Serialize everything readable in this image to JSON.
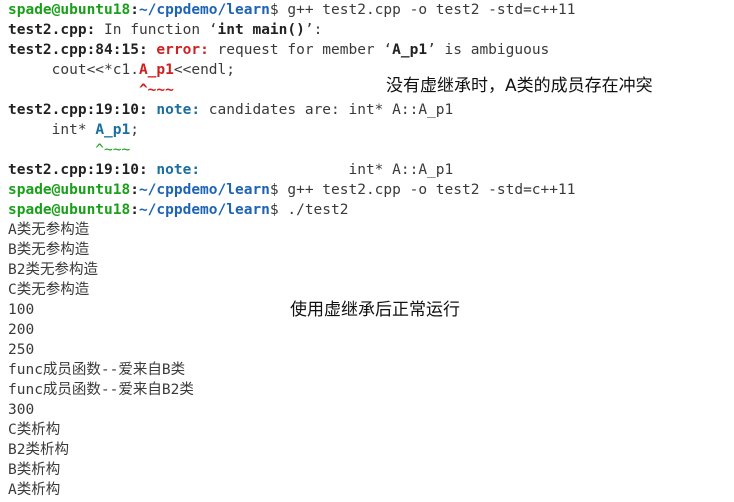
{
  "prompt": {
    "user": "spade@ubuntu18",
    "sep": ":",
    "path": "~/cppdemo/learn",
    "symbol": "$"
  },
  "cmd1": " g++ test2.cpp -o test2 -std=c++11",
  "l2": {
    "file": "test2.cpp:",
    "text": " In function ",
    "quote_open": "‘",
    "fn": "int main()",
    "quote_close": "’:"
  },
  "l3": {
    "loc": "test2.cpp:84:15:",
    "kind": " error:",
    "msg": " request for member ",
    "q1": "‘",
    "member": "A_p1",
    "q2": "’",
    "tail": " is ambiguous"
  },
  "l4": {
    "pre": "     cout<<*c1.",
    "hl": "A_p1",
    "post": "<<endl;"
  },
  "l5": {
    "marker": "               ^~~~"
  },
  "l6": {
    "loc": "test2.cpp:19:10:",
    "kind": " note:",
    "msg": " candidates are: int* A::A_p1"
  },
  "l7": {
    "pre": "     int* ",
    "hl": "A_p1",
    "post": ";"
  },
  "l8": {
    "marker": "          ^~~~"
  },
  "l9": {
    "loc": "test2.cpp:19:10:",
    "kind": " note:",
    "msg": "                 int* A::A_p1"
  },
  "cmd2": " g++ test2.cpp -o test2 -std=c++11",
  "cmd3": " ./test2",
  "output": [
    "A类无参构造",
    "B类无参构造",
    "B2类无参构造",
    "C类无参构造",
    "100",
    "200",
    "250",
    "func成员函数--爱来自B类",
    "func成员函数--爱来自B2类",
    "300",
    "C类析构",
    "B2类析构",
    "B类析构",
    "A类析构"
  ],
  "annotations": {
    "a1": "没有虚继承时，A类的成员存在冲突",
    "a2": "使用虚继承后正常运行"
  }
}
